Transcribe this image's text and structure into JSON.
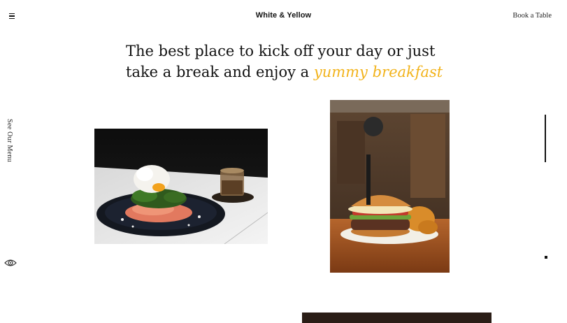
{
  "header": {
    "menu_icon": "hamburger-icon",
    "brand": "White & Yellow",
    "book_link": "Book a Table"
  },
  "sidebar": {
    "menu_link": "See Our Menu",
    "bottom_icon": "eye-icon"
  },
  "hero": {
    "line1": "The best place to kick off your day or just",
    "line2_plain": "take a break and enjoy a ",
    "line2_accent": "yummy breakfast",
    "accent_color": "#f2b31b"
  }
}
